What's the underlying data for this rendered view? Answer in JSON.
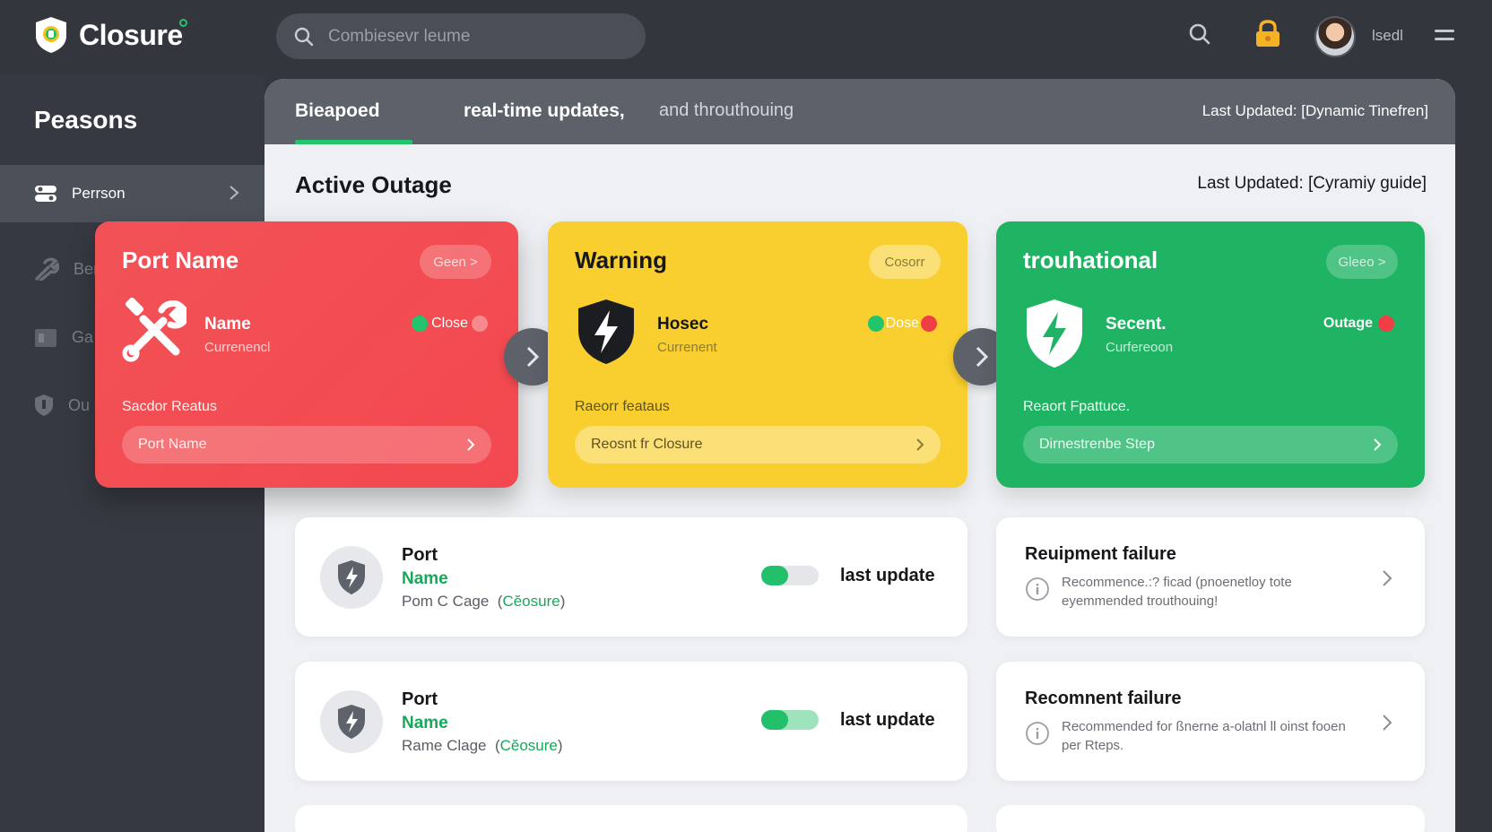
{
  "app": {
    "name": "Closure"
  },
  "search": {
    "placeholder": "Combiesevr leume"
  },
  "user": {
    "name": "lsedl"
  },
  "sidebar": {
    "title": "Peasons",
    "items": [
      {
        "label": "Perrson",
        "active": true
      },
      {
        "label": "Ber",
        "active": false
      },
      {
        "label": "Ga",
        "active": false
      },
      {
        "label": "Ou",
        "active": false
      }
    ]
  },
  "tabs": [
    {
      "label": "Bieapoed",
      "active": true
    },
    {
      "label": "real-time updates,",
      "active": false
    },
    {
      "label": "and throuthouing",
      "active": false
    }
  ],
  "tab_updated": "Last Updated: [Dynamic Tinefren]",
  "section": {
    "title": "Active Outage",
    "updated": "Last Updated: [Cyramiy guide]"
  },
  "cards": [
    {
      "color": "#f25257",
      "title": "Port Name",
      "pill": "Geen >",
      "name": "Name",
      "sub": "Currenencl",
      "status": "Close",
      "reason": "Sacdor Reatus",
      "select": "Port Name",
      "icon": "wrench-screwdriver-icon"
    },
    {
      "color": "#f9cf2f",
      "title": "Warning",
      "pill": "Cosorr",
      "name": "Hosec",
      "sub": "Currenent",
      "status": "Dose",
      "reason": "Raeorr feataus",
      "select": "Reosnt fr Closure",
      "icon": "shield-bolt-icon"
    },
    {
      "color": "#1fb364",
      "title": "trouhational",
      "pill": "Gleeo >",
      "name": "Secent.",
      "sub": "Curfereoon",
      "status": "Outage",
      "reason": "Reaort Fpattuce.",
      "select": "Dirnestrenbe Step",
      "icon": "shield-bolt-icon"
    }
  ],
  "rows": [
    {
      "title": "Port",
      "name": "Name",
      "sub": "Pom C Cage",
      "sub_hl": "Cĕosure",
      "toggle": "off",
      "update": "last update"
    },
    {
      "title": "Port",
      "name": "Name",
      "sub": "Rame Clage",
      "sub_hl": "Cĕosure",
      "toggle": "on",
      "update": "last update"
    }
  ],
  "infos": [
    {
      "title": "Reuipment failure",
      "text": "Recommence.:? ficad (pnoenetloy tote eyemmended trouthouing!"
    },
    {
      "title": "Recomnent failure",
      "text": "Recommended for ßnerne a-olatnl ll oinst fooen per Rteps."
    }
  ],
  "colors": {
    "accent": "#22c56b",
    "danger": "#f25257",
    "warning": "#f9cf2f",
    "success": "#1fb364"
  }
}
